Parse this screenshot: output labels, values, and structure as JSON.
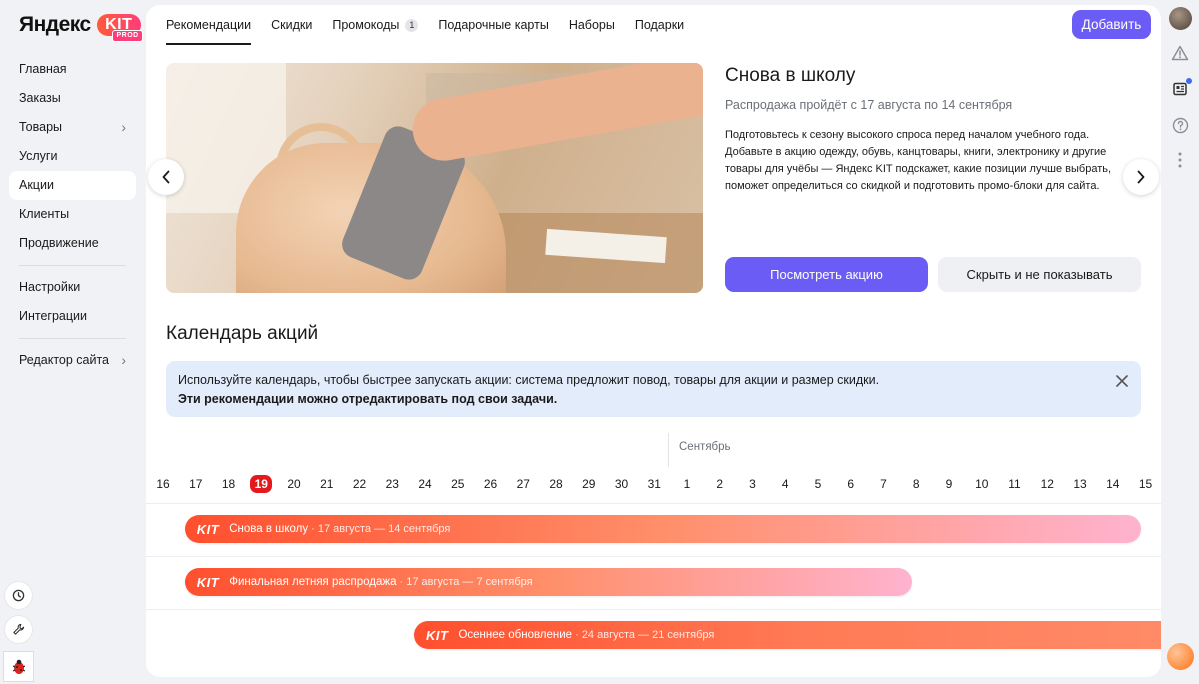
{
  "brand": {
    "name": "Яндекс",
    "kit": "KIT",
    "badge": "PROD"
  },
  "sidebar": {
    "items": [
      {
        "label": "Главная"
      },
      {
        "label": "Заказы"
      },
      {
        "label": "Товары",
        "chevron": true
      },
      {
        "label": "Услуги"
      },
      {
        "label": "Акции",
        "active": true
      },
      {
        "label": "Клиенты"
      },
      {
        "label": "Продвижение"
      },
      {
        "label": "Настройки"
      },
      {
        "label": "Интеграции"
      },
      {
        "label": "Редактор сайта",
        "chevron": true
      }
    ],
    "tools": [
      "clock-icon",
      "wrench-icon",
      "bug-icon"
    ]
  },
  "tabs": [
    {
      "label": "Рекомендации",
      "active": true
    },
    {
      "label": "Скидки"
    },
    {
      "label": "Промокоды",
      "badge": "1"
    },
    {
      "label": "Подарочные карты"
    },
    {
      "label": "Наборы"
    },
    {
      "label": "Подарки"
    }
  ],
  "header": {
    "add_label": "Добавить"
  },
  "promo": {
    "title": "Снова в школу",
    "subtitle": "Распродажа пройдёт с 17 августа по 14 сентября",
    "description": "Подготовьтесь к сезону высокого спроса перед началом учебного года. Добавьте в акцию одежду, обувь, канцтовары, книги, электронику и другие товары для учёбы — Яндекс KIT подскажет, какие позиции лучше выбрать, поможет определиться со скидкой и подготовить промо-блоки для сайта.",
    "primary_label": "Посмотреть акцию",
    "secondary_label": "Скрыть и не показывать",
    "prev_icon": "chevron-left-icon",
    "next_icon": "chevron-right-icon"
  },
  "calendar": {
    "title": "Календарь акций",
    "info_line1": "Используйте календарь, чтобы быстрее запускать акции: система предложит повод, товары для акции и размер скидки.",
    "info_line2": "Эти рекомендации можно отредактировать под свои задачи.",
    "month_label": "Сентябрь",
    "days": [
      "16",
      "17",
      "18",
      "19",
      "20",
      "21",
      "22",
      "23",
      "24",
      "25",
      "26",
      "27",
      "28",
      "29",
      "30",
      "31",
      "1",
      "2",
      "3",
      "4",
      "5",
      "6",
      "7",
      "8",
      "9",
      "10",
      "11",
      "12",
      "13",
      "14",
      "15"
    ],
    "today": "19",
    "events": [
      {
        "kit": "KIT",
        "name": "Снова в школу",
        "dates": "· 17 августа — 14 сентября",
        "start_index": 1,
        "end_index": 29.5,
        "colors": [
          "#ff4f2e",
          "#ff8f6a",
          "#ffb3cf"
        ]
      },
      {
        "kit": "KIT",
        "name": "Финальная летняя распродажа",
        "dates": "· 17 августа — 7 сентября",
        "start_index": 1,
        "end_index": 22.5,
        "colors": [
          "#ff4f2e",
          "#ff8f6a",
          "#ffb3cf"
        ]
      },
      {
        "kit": "KIT",
        "name": "Осеннее обновление",
        "dates": "· 24 августа — 21 сентября",
        "start_index": 8,
        "end_index": 31,
        "colors": [
          "#ff4f2e",
          "#ff7a55",
          "#ff8b68"
        ]
      }
    ]
  },
  "rail": {
    "icons": [
      "avatar",
      "warning-icon",
      "news-icon",
      "help-icon",
      "more-icon"
    ]
  }
}
